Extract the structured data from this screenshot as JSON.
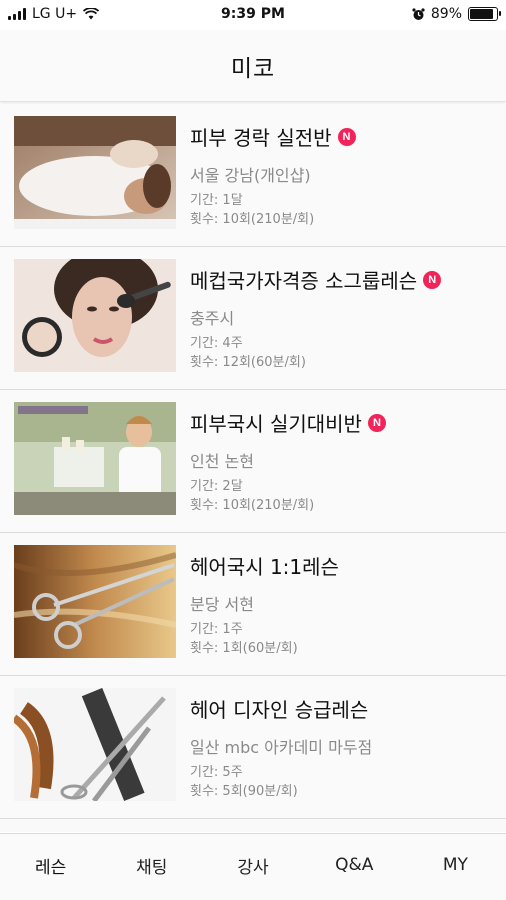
{
  "status_bar": {
    "carrier": "LG U+",
    "time": "9:39 PM",
    "battery_percent": "89%",
    "battery_level": 0.89,
    "icons": [
      "signal-icon",
      "wifi-icon",
      "alarm-icon",
      "battery-icon"
    ]
  },
  "header": {
    "title": "미코"
  },
  "lessons": [
    {
      "title": "피부 경락 실전반",
      "is_new": true,
      "location": "서울 강남(개인샵)",
      "period": "기간: 1달",
      "count": "횟수: 10회(210분/회)",
      "thumbnail": "spa-massage-photo"
    },
    {
      "title": "메컵국가자격증 소그룹레슨",
      "is_new": true,
      "location": "충주시",
      "period": "기간: 4주",
      "count": "횟수: 12회(60분/회)",
      "thumbnail": "makeup-model-photo"
    },
    {
      "title": "피부국시 실기대비반",
      "is_new": true,
      "location": "인천 논현",
      "period": "기간: 2달",
      "count": "횟수: 10회(210분/회)",
      "thumbnail": "skincare-instructor-photo"
    },
    {
      "title": "헤어국시 1:1레슨",
      "is_new": false,
      "location": "분당 서현",
      "period": "기간: 1주",
      "count": "횟수: 1회(60분/회)",
      "thumbnail": "hair-scissors-photo"
    },
    {
      "title": "헤어 디자인 승급레슨",
      "is_new": false,
      "location": "일산 mbc 아카데미 마두점",
      "period": "기간: 5주",
      "count": "횟수: 5회(90분/회)",
      "thumbnail": "hair-cut-tools-photo"
    }
  ],
  "new_badge_label": "N",
  "tab_bar": {
    "tabs": [
      {
        "label": "레슨",
        "active": true
      },
      {
        "label": "채팅",
        "active": false
      },
      {
        "label": "강사",
        "active": false
      },
      {
        "label": "Q&A",
        "active": false
      },
      {
        "label": "MY",
        "active": false
      }
    ]
  },
  "colors": {
    "badge": "#f0245a",
    "text_primary": "#111111",
    "text_secondary": "#8a8a8a",
    "divider": "#dcdcdc"
  }
}
